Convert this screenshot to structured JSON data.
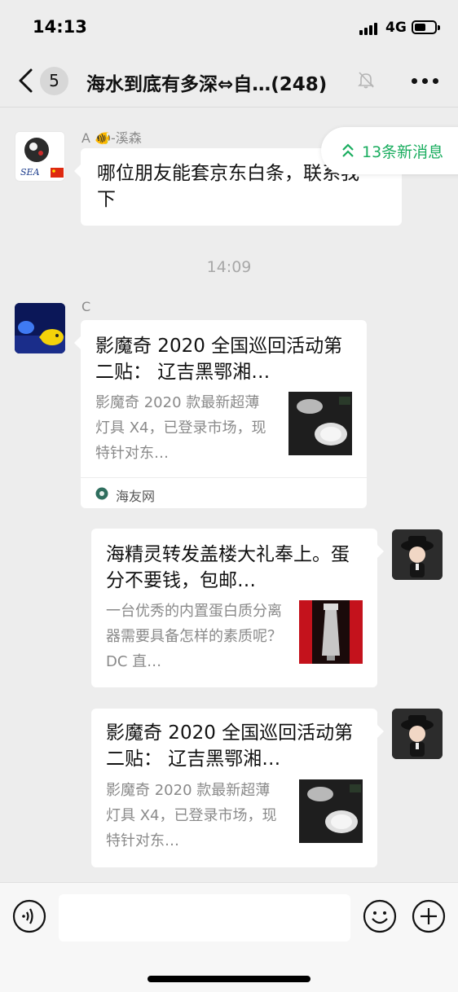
{
  "status_bar": {
    "time": "14:13",
    "network": "4G"
  },
  "nav": {
    "back_count": "5",
    "title": "海水到底有多深⇔自…(248)"
  },
  "new_messages": {
    "label": "13条新消息"
  },
  "messages": [
    {
      "sender": "A 🐠-溪森",
      "text": "哪位朋友能套京东白条，联系我一下"
    },
    {
      "timestamp": "14:09"
    },
    {
      "sender": "C",
      "card": {
        "title": "影魔奇 2020 全国巡回活动第二贴： 辽吉黑鄂湘…",
        "desc": "影魔奇 2020 款最新超薄灯具 X4，已登录市场，现特针对东…",
        "source": "海友网"
      }
    },
    {
      "card": {
        "title": "海精灵转发盖楼大礼奉上。蛋分不要钱，包邮…",
        "desc": "一台优秀的内置蛋白质分离器需要具备怎样的素质呢？DC 直…"
      }
    },
    {
      "card": {
        "title": "影魔奇 2020 全国巡回活动第二贴： 辽吉黑鄂湘…",
        "desc": "影魔奇 2020 款最新超薄灯具 X4，已登录市场，现特针对东…"
      }
    }
  ],
  "input_bar": {
    "value": "",
    "placeholder": ""
  },
  "icons": {
    "back": "back-icon",
    "mute": "mute-icon",
    "more": "more-icon",
    "new_messages": "double-chevron-up-icon",
    "voice": "voice-icon",
    "emoji": "emoji-icon",
    "plus": "plus-icon",
    "source": "globe-icon"
  },
  "colors": {
    "accent": "#1aad5f",
    "background": "#ededed",
    "bubble": "#ffffff"
  }
}
